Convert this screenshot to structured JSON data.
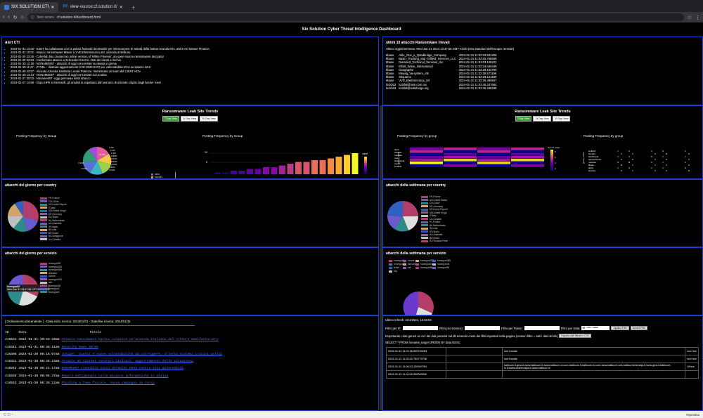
{
  "browser": {
    "tabs": [
      {
        "label": "SIX SOLUTION CTI"
      },
      {
        "label": "view-source:cf.solution.it/"
      }
    ],
    "address": {
      "security": "Non sicuro",
      "url": "cf.solution.it/dashboard.html"
    }
  },
  "dashboard": {
    "title": "Six Solution Cyber Threat Intelligence Dashboard"
  },
  "alert_cti": {
    "title": "Alert CTI",
    "items": [
      "2024-01-31 13:25 - ESET ha collaborato con la polizia federale del Brasile per interrompere le attività della botnet Grandoreiro, attiva nel settore Finance.",
      "2024-01-31 10:01 - Attacco ransomware 8Base a VVD Elettrotecnica Srl, azienda di Belluno",
      "2024-01-30 23:25 - Cyberlab has created an online version of 'White Phoenix', an open-source ransomware decryptor",
      "2024-01-30 22:53 - Confermato attacco a Schneider Electric. Dati dei clienti a rischio.",
      "2024-01-30 12:19 - NONAME057 - attacchi di oggi concentrati su olanda e grecia",
      "2024-01-30 11:27 - ZYXEL - rilasciati aggiornamenti CVE-2023-5372 per vulnerabilità HIGH su sistemi NAS",
      "2024-01-29 23:57 - Allocuta Azienda Sanitaria Locale Potenza. Interessato un team del CSIRT ACN",
      "2024-01-29 13:43 - NONAME057 - attacchi di oggi concentrati su Ucraina.",
      "2024-01-27 20:02 - Noname057 -oggi germania sotto attacco",
      "2024-01-27 14:59 - Dopo HPE e Microsoft, gli analisti si aspettano altri annunci di aziende colpite dagli hacker russi"
    ]
  },
  "ransomware": {
    "title": "ultimi 10 attacchi Ransomware rilevati",
    "updated": "Ultimo aggiornamento: Wed Jan 31 2024 13:47:56 GMT+0100 (Ora standard dell'Europa centrale)",
    "rows": [
      {
        "group": "8base",
        "victim": "Able_One_a_Quadbridge_Company",
        "date": "2024-01-31 11:02:03.841256"
      },
      {
        "group": "8base",
        "victim": "Basin_Trucking_and_Oilfield_Services_LLC",
        "date": "2024-01-31 11:02:03.765845"
      },
      {
        "group": "8base",
        "victim": "Diamond_Technical_Services_Inc.",
        "date": "2024-01-31 11:02:03.105222"
      },
      {
        "group": "8base",
        "victim": "Elliott_Wave_International",
        "date": "2024-01-31 11:02:24.046449"
      },
      {
        "group": "8base",
        "victim": "Geographe",
        "date": "2024-01-31 11:02:25.192790"
      },
      {
        "group": "8base",
        "victim": "Meaag_Va-system_AB",
        "date": "2024-01-31 11:02:26.571196"
      },
      {
        "group": "8base",
        "victim": "Sitquarco",
        "date": "2024-01-31 11:02:28.121649"
      },
      {
        "group": "8base",
        "victim": "VVD_Elettrotecnica_Srl",
        "date": "2024-01-31 11:02:28.496847"
      },
      {
        "group": "lockbit3",
        "victim": "lockbit@nsm.com.mx",
        "date": "2024-01-31 11:02:45.247664"
      },
      {
        "group": "lockbit3",
        "victim": "lockbit@saltofcago.org",
        "date": "2024-01-31 11:02:45.346348"
      }
    ]
  },
  "trends_left": {
    "title": "Ransomware Leak Site Trends",
    "buttons": [
      "7 Day View",
      "14 Day View",
      "30 Day View"
    ],
    "pie_title": "Posting Frequency by Group",
    "bar_title": "Posting Frequency by Group",
    "pie_labels": [
      "1.2%",
      "1.2%",
      "1.2%",
      "3.65%",
      "3.61%",
      "2.82%",
      "4.62%",
      "14.5%",
      "7.23%",
      "7.23%",
      "4.82%",
      "6.02%"
    ],
    "legend": [
      "akira",
      "lockbit3",
      "blackbasta",
      "8base",
      "alphv",
      "bianlian",
      "ransomexx"
    ],
    "colorbar_label": "count",
    "y_ticks": [
      "10",
      "5"
    ],
    "y_label": "count",
    "bars": [
      1,
      1,
      2,
      2,
      3,
      3,
      4,
      4,
      5,
      6,
      7,
      7,
      8,
      8,
      9,
      10,
      11,
      12
    ],
    "bar_max": 12
  },
  "trends_right": {
    "title": "Ransomware Leak Site Trends",
    "buttons": [
      "7 Day View",
      "14 Day View",
      "30 Day View"
    ],
    "heat_title": "Posting Frequency by group",
    "scatter_title": "Posting Frequency by group",
    "heat_ylabels": [
      "alphv",
      "bianlian",
      "medusa",
      "ryuk",
      "blackbasta",
      "cactus",
      "lockbit3"
    ],
    "heat_ylabel": "group_name",
    "colorbar_label": "sum of count",
    "colorbar_ticks": [
      "8",
      "6",
      "4",
      "2"
    ],
    "scatter_ylabels": [
      "lockbit3",
      "hunters",
      "blackbasta",
      "ransomhouse",
      "medusa",
      "8base",
      "alphv",
      "bianlian"
    ],
    "scatter_ylabel": "group_name"
  },
  "country_day": {
    "title": "attacchi del giorno per country",
    "legend": [
      "FR,France",
      "CN,China",
      "US,Korea Republ",
      "IT,Italy",
      "GB,United Kingd",
      "DE,Germany",
      "ES,Spain",
      "NL,Netherlands",
      "AU,Australia",
      "JP,Japan",
      "IN,India",
      "BR,Brazil",
      "SG,Singapore",
      "CA,Canada"
    ]
  },
  "country_week": {
    "title": "attacchi della settimana per country",
    "legend": [
      "FR,France",
      "US,United States",
      "CN,China",
      "DE,Germany",
      "KR,Korea Republ",
      "GB,United Kingd",
      "IT,Italy",
      "CA,Canada",
      "PL,Poland",
      "NL,Netherlands",
      "IN,India",
      "ES,Spain",
      "AU,Australia",
      "BR,Brazil",
      "RU,Russian Fede"
    ]
  },
  "service_day": {
    "title": "attacchi del giorno per servizio",
    "tooltip_label": "honeypot2",
    "tooltip_text": "Wed Jan 31 13:47:56 CET 2024 : 779",
    "legend": [
      "honeypot32",
      "honeypot333",
      "honeypot366",
      "dionaea",
      "cowrie",
      "honeypot333",
      "ssh",
      "honeypot33",
      "honeypot2",
      "honeypot3"
    ]
  },
  "service_week": {
    "title": "attacchi della settimana per servizio",
    "legend_a": [
      "honeypot2",
      "cowrie",
      "honeypot33",
      "dionaea",
      "telnet",
      "ssh",
      "rdp"
    ],
    "legend_b": [
      "honeypot333",
      "honeypot366",
      "honeypot43",
      "honeypot78",
      "honeypot55",
      "honeypot90"
    ]
  },
  "results": {
    "header": "[ Ordinamento discendente ] - Data inizio ricerca: 2024/01/01 - Data fine ricerca: 2024/01/31",
    "col_id": "ID",
    "col_date": "Data",
    "col_title": "Titolo",
    "rows": [
      {
        "id": "416522",
        "date": "2024-01-31 10:52:10am",
        "title": "Attacco ransomware Cactus colpisce un'azienda italiana del settore manifatturiero"
      },
      {
        "id": "416312",
        "date": "2024-01-31 09:49:11am",
        "title": "Security News 30/01"
      },
      {
        "id": "416408",
        "date": "2024-01-30 09:16:07am",
        "title": "Juniper, Ivanti e nuove vulnerabilità da correggere, allerta sistemi critici attivi"
      },
      {
        "id": "416321",
        "date": "2024-01-30 06:28:23am",
        "title": "Attacco ai sistemi sanitari italiani, aggiornamento della situazione"
      },
      {
        "id": "416542",
        "date": "2024-01-30 08:21:17am",
        "title": "NONAME057 rivendica nuovi attacchi DDoS contro siti governativi"
      },
      {
        "id": "416568",
        "date": "2024-01-30 08:05:37am",
        "title": "Report settimanale sulle minacce informatiche in Italia"
      },
      {
        "id": "416553",
        "date": "2024-01-30 06:26:12am",
        "title": "Phishing a tema fiscale, nuova campagna in corso"
      }
    ]
  },
  "ip_panel": {
    "refresh": "Ultimo refresh: 31/1/2024, 13:48:04",
    "filter_ip": "Filtro per IP:",
    "filter_domain": "Filtro per Dominio:",
    "filter_country": "Filtro per Paese:",
    "filter_date": "Filtro per Data:",
    "date_placeholder": "gg / mm / aaaa",
    "apply": "Applica Filtri",
    "reset": "Azzera Filtri",
    "export_note": "Esportando i dati generi un csv dei dati presenti nel db tenendo conto dei filtri impostati nella pagina (nessun filtro = tutti i dati del db)",
    "export_btn": "Esporta dati filtrati in CSV",
    "query": "SELECT * FROM noname_target ORDER BY data DESC",
    "rows": [
      {
        "date": "2024-01-31 11:01:26.500749283",
        "ip": "",
        "status": "non trovato",
        "extra": "non trov"
      },
      {
        "date": "2024-01-31 11:00:22.750779738",
        "ip": "",
        "status": "non trovato",
        "extra": "non trov"
      },
      {
        "date": "2024-01-31 11:00:13.130947254",
        "ip": "",
        "status": "balticum.lt,giva.lt,www.balticum.lt,www.balticum-tv.com,balticum.lt,balticum-tv.com,www.balticum-tv.lt,balticumtelevizija.lt,www.giva.lt,balticum-tv.lt,balticumtelevizija.lt,www.balticum.lt",
        "extra": "Lithua"
      },
      {
        "date": "2024-01-31 11:00:00.000000000",
        "ip": "",
        "status": "",
        "extra": ""
      }
    ]
  },
  "statusbar": {
    "right": "Ripristina"
  }
}
